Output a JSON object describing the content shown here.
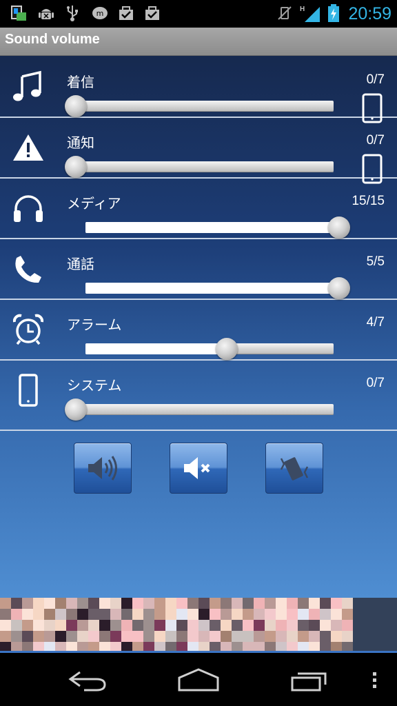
{
  "status_bar": {
    "time": "20:59",
    "network_type": "H",
    "icons": [
      "app-notification-icon",
      "android-debug-icon",
      "usb-icon",
      "messaging-icon",
      "download-done-icon",
      "download-done-icon",
      "vibrate-mute-icon",
      "signal-icon",
      "battery-charging-icon"
    ]
  },
  "title": "Sound volume",
  "rows": [
    {
      "label": "着信",
      "value": "0/7",
      "level": 0.0,
      "icon": "music-note-icon",
      "side_icon": "phone-icon"
    },
    {
      "label": "通知",
      "value": "0/7",
      "level": 0.0,
      "icon": "warning-icon",
      "side_icon": "phone-icon"
    },
    {
      "label": "メディア",
      "value": "15/15",
      "level": 1.0,
      "icon": "headphones-icon"
    },
    {
      "label": "通話",
      "value": "5/5",
      "level": 1.0,
      "icon": "phone-handset-icon"
    },
    {
      "label": "アラーム",
      "value": "4/7",
      "level": 0.57,
      "icon": "alarm-clock-icon"
    },
    {
      "label": "システム",
      "value": "0/7",
      "level": 0.0,
      "icon": "smartphone-icon"
    }
  ],
  "mode_buttons": [
    {
      "icon": "speaker-sound-icon"
    },
    {
      "icon": "speaker-mute-icon"
    },
    {
      "icon": "vibrate-icon"
    }
  ],
  "colors": {
    "accent_clock": "#33b5e5",
    "signal": "#33b5e5"
  },
  "nav": [
    "back-icon",
    "home-icon",
    "recents-icon",
    "menu-icon"
  ]
}
